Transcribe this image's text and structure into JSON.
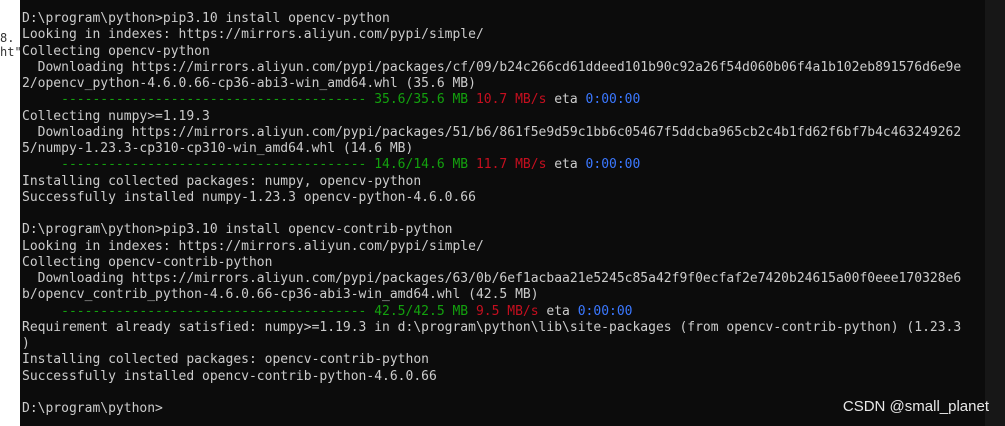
{
  "background_window": {
    "fragments": [
      "8.",
      "ht\""
    ]
  },
  "colors": {
    "background": "#0c0c0c",
    "text": "#cccccc",
    "progress_bar": "#13a10e",
    "speed": "#c50f1f",
    "eta": "#3b78ff"
  },
  "install1": {
    "command": "D:\\program\\python>pip3.10 install opencv-python",
    "index": "Looking in indexes: https://mirrors.aliyun.com/pypi/simple/",
    "collecting": "Collecting opencv-python",
    "download_url_1": "  Downloading https://mirrors.aliyun.com/pypi/packages/cf/09/b24c266cd61ddeed101b90c92a26f54d060b06f4a1b102eb891576d6e9e",
    "download_url_2": "2/opencv_python-4.6.0.66-cp36-abi3-win_amd64.whl (35.6 MB)",
    "progress": {
      "bar": "     ---------------------------------------",
      "size": "35.6/35.6 MB",
      "speed": "10.7 MB/s",
      "eta_label": "eta",
      "eta": "0:00:00"
    }
  },
  "numpy": {
    "collecting": "Collecting numpy>=1.19.3",
    "download_url_1": "  Downloading https://mirrors.aliyun.com/pypi/packages/51/b6/861f5e9d59c1bb6c05467f5ddcba965cb2c4b1fd62f6bf7b4c463249262",
    "download_url_2": "5/numpy-1.23.3-cp310-cp310-win_amd64.whl (14.6 MB)",
    "progress": {
      "bar": "     ---------------------------------------",
      "size": "14.6/14.6 MB",
      "speed": "11.7 MB/s",
      "eta_label": "eta",
      "eta": "0:00:00"
    },
    "installing": "Installing collected packages: numpy, opencv-python",
    "success": "Successfully installed numpy-1.23.3 opencv-python-4.6.0.66"
  },
  "install2": {
    "command": "D:\\program\\python>pip3.10 install opencv-contrib-python",
    "index": "Looking in indexes: https://mirrors.aliyun.com/pypi/simple/",
    "collecting": "Collecting opencv-contrib-python",
    "download_url_1": "  Downloading https://mirrors.aliyun.com/pypi/packages/63/0b/6ef1acbaa21e5245c85a42f9f0ecfaf2e7420b24615a00f0eee170328e6",
    "download_url_2": "b/opencv_contrib_python-4.6.0.66-cp36-abi3-win_amd64.whl (42.5 MB)",
    "progress": {
      "bar": "     ---------------------------------------",
      "size": "42.5/42.5 MB",
      "speed": "9.5 MB/s",
      "eta_label": "eta",
      "eta": "0:00:00"
    },
    "requirement_1": "Requirement already satisfied: numpy>=1.19.3 in d:\\program\\python\\lib\\site-packages (from opencv-contrib-python) (1.23.3",
    "requirement_2": ")",
    "installing": "Installing collected packages: opencv-contrib-python",
    "success": "Successfully installed opencv-contrib-python-4.6.0.66"
  },
  "final_prompt": "D:\\program\\python>",
  "watermark": "CSDN @small_planet"
}
